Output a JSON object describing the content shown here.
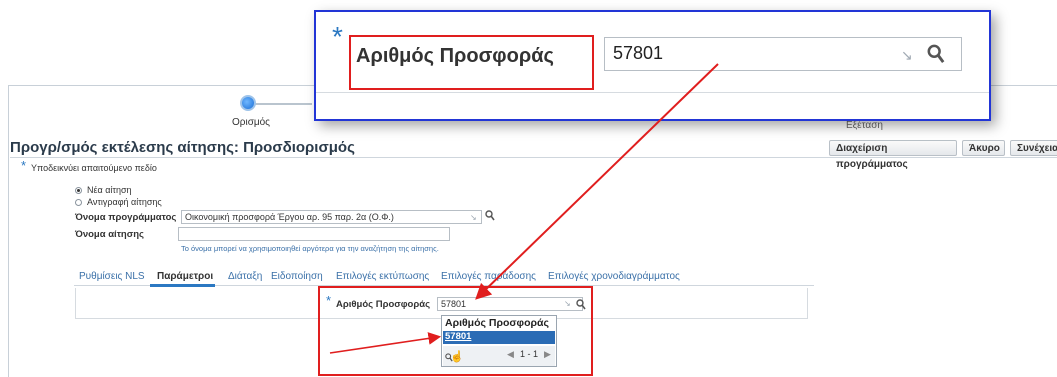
{
  "train": {
    "step1": "Ορισμός",
    "step_last": "Εξέταση"
  },
  "page_title": "Προγρ/σμός εκτέλεσης αίτησης: Προσδιορισμός",
  "toolbar": {
    "manage_label": "Διαχείριση προγράμματος",
    "cancel_label": "Άκυρο",
    "continue_label": "Συνέχεια"
  },
  "required_note": "Υποδεικνύει απαιτούμενο πεδίο",
  "required_star": "*",
  "request_type": {
    "new_label": "Νέα αίτηση",
    "copy_label": "Αντιγραφή αίτησης",
    "selected": "new"
  },
  "program_name": {
    "label": "Όνομα προγράμματος",
    "value": "Οικονομική προσφορά Έργου αρ. 95 παρ. 2α (Ο.Φ.)"
  },
  "request_name": {
    "label": "Όνομα αίτησης",
    "value": "",
    "hint": "Το όνομα μπορεί να χρησιμοποιηθεί αργότερα για την αναζήτηση της αίτησης."
  },
  "tabs": [
    "Ρυθμίσεις NLS",
    "Παράμετροι",
    "Διάταξη",
    "Ειδοποίηση",
    "Επιλογές εκτύπωσης",
    "Επιλογές παράδοσης",
    "Επιλογές χρονοδιαγράμματος"
  ],
  "active_tab": "Παράμετροι",
  "offer_field": {
    "label": "Αριθμός Προσφοράς",
    "value": "57801"
  },
  "lov_dropdown": {
    "header": "Αριθμός Προσφοράς",
    "option": "57801",
    "pager": "1 - 1"
  },
  "zoom": {
    "label": "Αριθμός Προσφοράς",
    "value": "57801"
  },
  "colors": {
    "accent": "#2b78c2",
    "annotation_red": "#e01e1e",
    "zoom_border": "#2235d6",
    "link": "#3a70a8"
  }
}
